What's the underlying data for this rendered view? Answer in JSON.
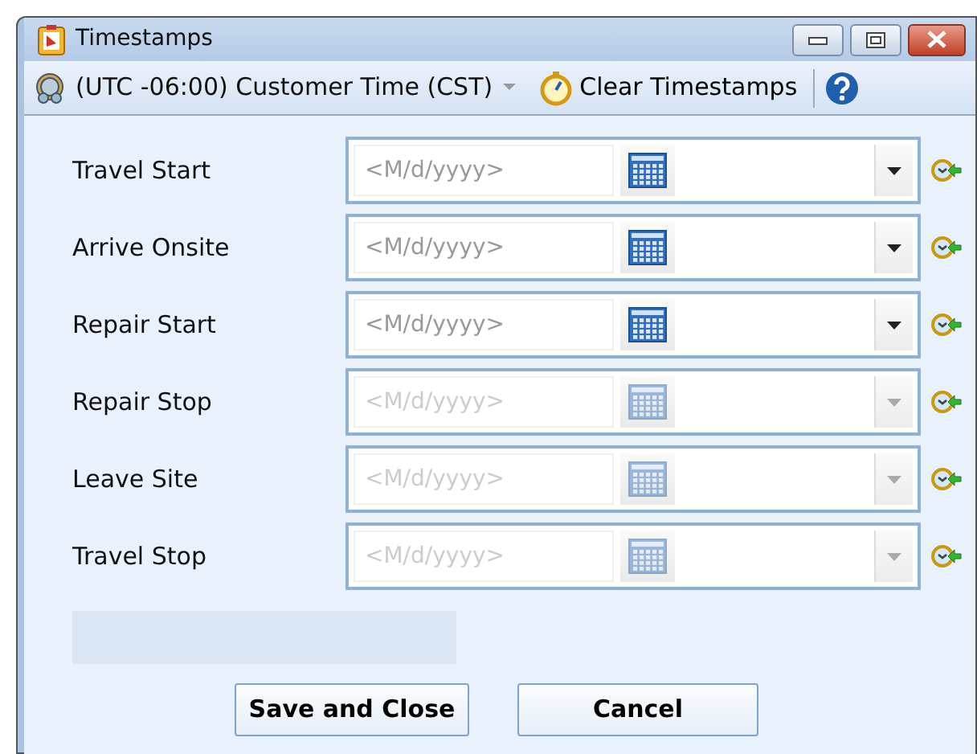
{
  "window": {
    "title": "Timestamps"
  },
  "toolbar": {
    "time_zone": "(UTC -06:00) Customer Time (CST)",
    "clear_button": "Clear Timestamps"
  },
  "rows": [
    {
      "label": "Travel Start",
      "placeholder": "<M/d/yyyy>",
      "disabled": false
    },
    {
      "label": "Arrive Onsite",
      "placeholder": "<M/d/yyyy>",
      "disabled": false
    },
    {
      "label": "Repair Start",
      "placeholder": "<M/d/yyyy>",
      "disabled": false
    },
    {
      "label": "Repair Stop",
      "placeholder": "<M/d/yyyy>",
      "disabled": true
    },
    {
      "label": "Leave Site",
      "placeholder": "<M/d/yyyy>",
      "disabled": true
    },
    {
      "label": "Travel Stop",
      "placeholder": "<M/d/yyyy>",
      "disabled": true
    }
  ],
  "buttons": [
    "Save and Close",
    "Cancel"
  ]
}
